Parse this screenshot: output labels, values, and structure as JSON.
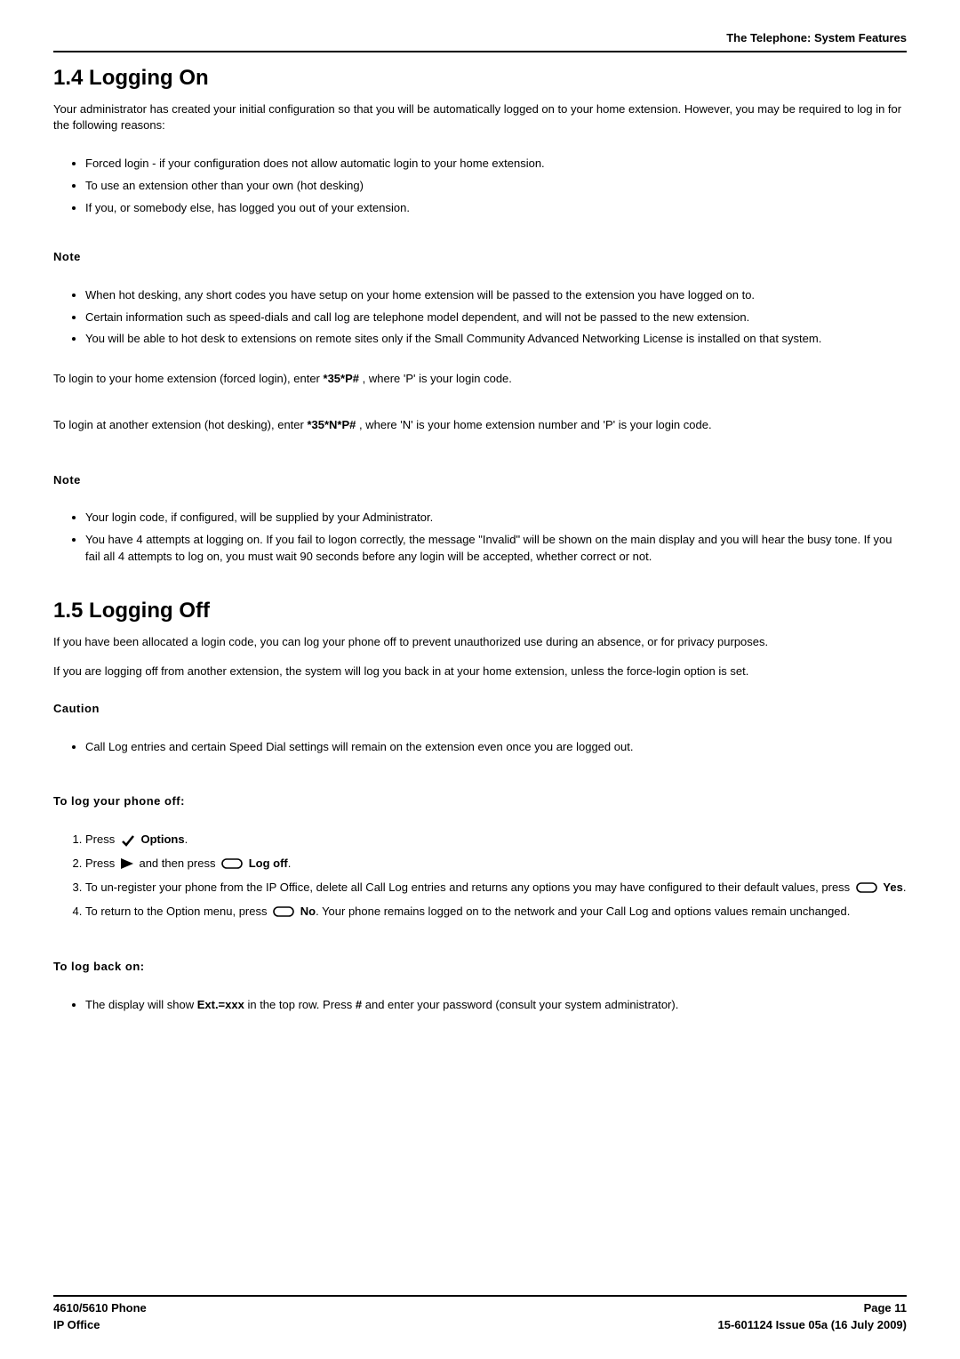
{
  "runhead": "The Telephone: System Features",
  "sec14": {
    "title": "1.4 Logging On",
    "intro": "Your administrator has created your initial configuration so that you will be automatically logged on to your home extension. However, you may be required to log in for the following reasons:",
    "reasons": [
      "Forced login - if your configuration does not  allow automatic login to your home extension.",
      "To use an extension other than your own (hot desking)",
      "If you, or somebody else, has logged you out of your extension."
    ],
    "note1_label": "Note",
    "note1_items": [
      "When hot desking, any short codes you have setup on your home extension will be passed to the extension you have logged on to.",
      "Certain information such as speed-dials and call log are telephone model dependent, and will not be passed to the new extension.",
      "You will be able to hot desk to extensions on remote sites only if the Small Community Advanced Networking License is installed on that system."
    ],
    "login_home_pre": "To login to your home extension (forced login), enter ",
    "login_home_code": "*35*P#",
    "login_home_post": ", where 'P' is your login code.",
    "login_other_pre": "To login at another extension (hot desking), enter ",
    "login_other_code": "*35*N*P#",
    "login_other_post": ", where 'N' is your home extension number and 'P' is your login code.",
    "note2_label": "Note",
    "note2_items": [
      "Your login code, if configured, will be supplied by your Administrator.",
      "You have 4 attempts at logging on. If you fail to logon correctly, the message \"Invalid\" will be shown on the main display and you will hear the busy tone. If you fail all 4 attempts to log on, you must wait 90 seconds before any login will be accepted, whether correct or not."
    ]
  },
  "sec15": {
    "title": "1.5 Logging Off",
    "p1": "If you have been allocated a login code, you can log your phone off to prevent unauthorized use during an absence, or for privacy purposes.",
    "p2": "If you are logging off from another extension, the system will log you back in at your home extension, unless the force-login option is set.",
    "caution_label": "Caution",
    "caution_items": [
      "Call Log entries and certain Speed Dial settings will remain on the extension even once you are logged out."
    ],
    "logoff_heading": "To log your phone off:",
    "step1_pre": "Press ",
    "step1_label": "Options",
    "step1_post": ".",
    "step2_pre": "Press ",
    "step2_mid": " and then press ",
    "step2_label": "Log off",
    "step2_post": ".",
    "step3_pre": "To un-register your phone from the IP Office, delete all Call Log entries and returns any options you may have configured to their default values, press ",
    "step3_label": "Yes",
    "step3_post": ".",
    "step4_pre": "To return to the Option menu, press ",
    "step4_label": "No",
    "step4_post": ". Your phone remains logged on to the network and your Call Log and options values remain unchanged.",
    "logback_heading": "To log back on:",
    "logback_pre": "The display will show ",
    "logback_code": "Ext.=xxx",
    "logback_mid": " in the top row. Press ",
    "logback_key": "#",
    "logback_post": " and enter your password (consult your system administrator)."
  },
  "footer": {
    "left1": "4610/5610 Phone",
    "left2": "IP Office",
    "right1": "Page 11",
    "right2": "15-601124 Issue 05a (16 July 2009)"
  }
}
